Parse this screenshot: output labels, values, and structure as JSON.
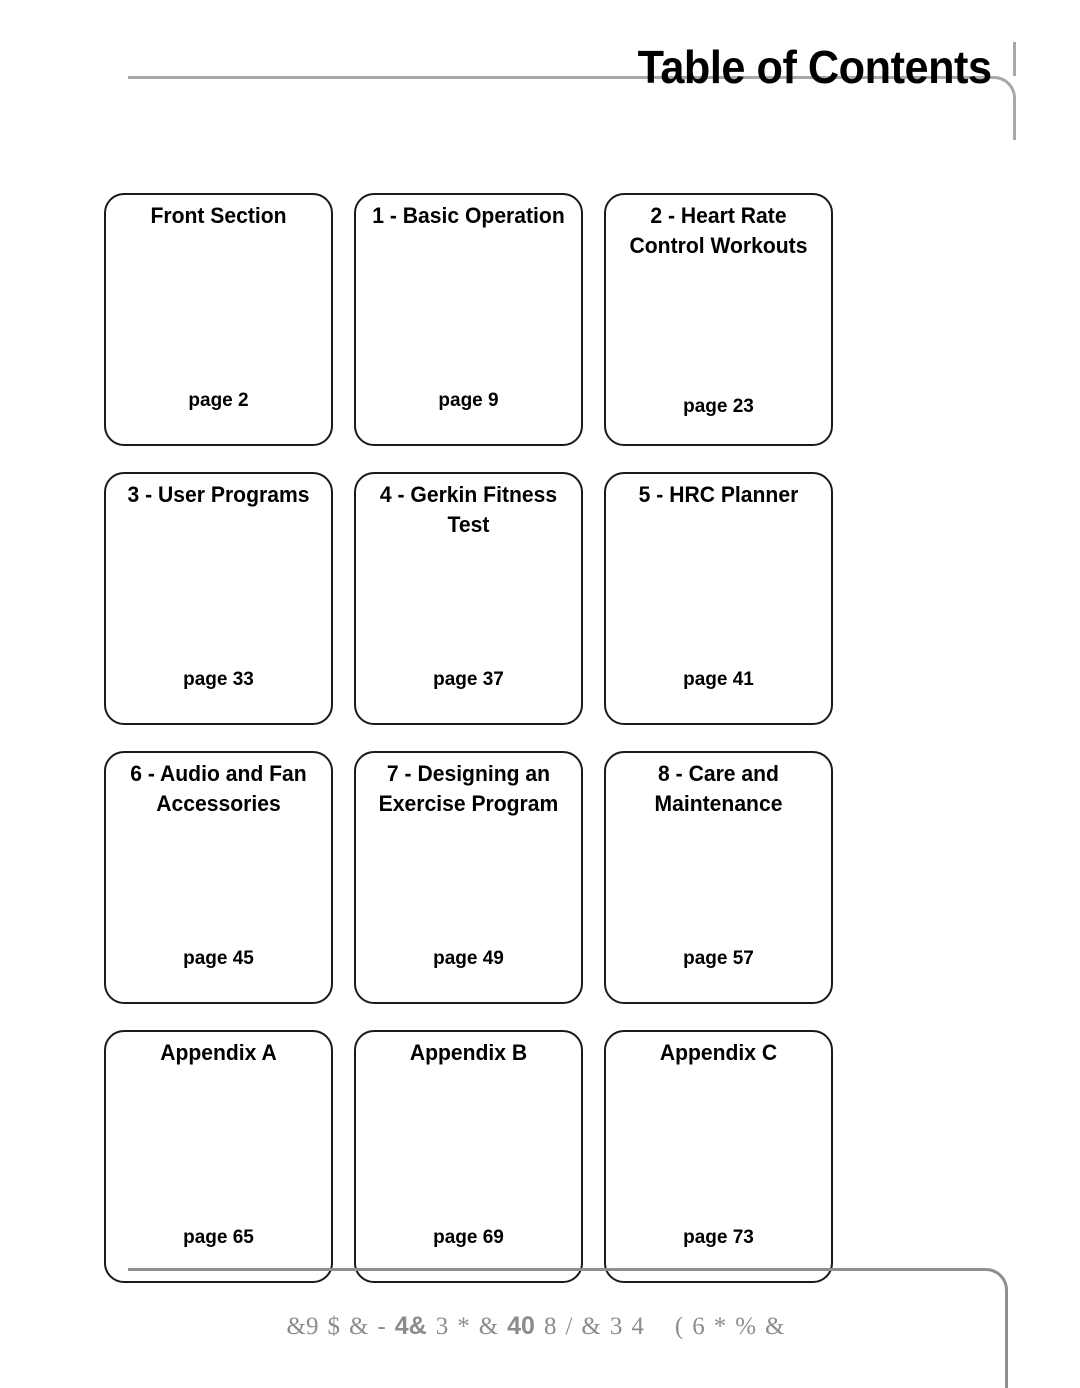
{
  "header": {
    "title": "Table of Contents"
  },
  "toc": {
    "cards": [
      {
        "title": "Front Section",
        "page_label": "page 2"
      },
      {
        "title": "1 - Basic Operation",
        "page_label": "page 9"
      },
      {
        "title": "2 - Heart Rate Control Workouts",
        "page_label": "page 23"
      },
      {
        "title": "3 - User Programs",
        "page_label": "page 33"
      },
      {
        "title": "4 - Gerkin Fitness Test",
        "page_label": "page 37"
      },
      {
        "title": "5 - HRC Planner",
        "page_label": "page 41"
      },
      {
        "title": "6 - Audio and Fan Accessories",
        "page_label": "page 45"
      },
      {
        "title": "7 - Designing an Exercise Program",
        "page_label": "page 49"
      },
      {
        "title": "8 - Care and Maintenance",
        "page_label": "page 57"
      },
      {
        "title": "Appendix A",
        "page_label": "page 65"
      },
      {
        "title": "Appendix B",
        "page_label": "page 69"
      },
      {
        "title": "Appendix C",
        "page_label": "page 73"
      }
    ]
  },
  "footer": {
    "glyphs": [
      "&9",
      "$",
      "&",
      "-",
      "4&",
      "3",
      "*",
      "&",
      "40",
      "8",
      "/",
      "&",
      "3",
      "4",
      "(",
      "6",
      "*",
      "%",
      "&"
    ]
  },
  "colors": {
    "rule": "#8f8f8f",
    "header_rule": "#a8a8a8",
    "card_border": "#1a1a1a",
    "text": "#000000",
    "footer_text": "#8c8c8c",
    "background": "#ffffff"
  }
}
